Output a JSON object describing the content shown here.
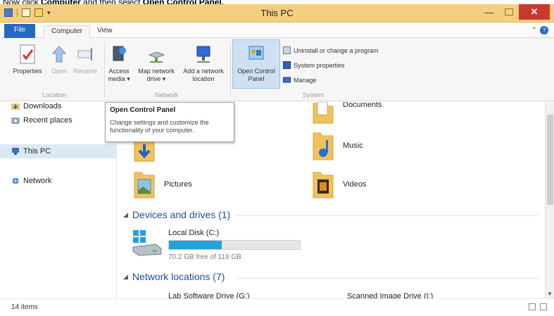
{
  "instruction": {
    "prefix": "Now click ",
    "bold1": "Computer",
    "middle": " and then select ",
    "bold2": "Open Control Panel."
  },
  "window": {
    "title": "This PC"
  },
  "tabs": [
    {
      "label": "File"
    },
    {
      "label": "Computer"
    },
    {
      "label": "View"
    }
  ],
  "ribbon": {
    "location": {
      "label": "Location",
      "properties": "Properties",
      "open": "Open",
      "rename": "Rename"
    },
    "network": {
      "label": "Network",
      "access_media": "Access media ▾",
      "map_drive": "Map network drive ▾",
      "add_location": "Add a network location"
    },
    "system": {
      "label": "System",
      "open_cp": "Open Control Panel",
      "uninstall": "Uninstall or change a program",
      "sys_props": "System properties",
      "manage": "Manage"
    }
  },
  "tooltip": {
    "title": "Open Control Panel",
    "body": "Change settings and customize the functionality of your computer."
  },
  "nav": {
    "items": [
      {
        "label": "Downloads"
      },
      {
        "label": "Recent places"
      },
      {
        "label": "This PC"
      },
      {
        "label": "Network"
      }
    ]
  },
  "folders": [
    {
      "label": "Documents"
    },
    {
      "label": "Downloads"
    },
    {
      "label": "Music"
    },
    {
      "label": "Pictures"
    },
    {
      "label": "Videos"
    }
  ],
  "sections": {
    "devices": "Devices and drives (1)",
    "network": "Network locations (7)"
  },
  "drive": {
    "name": "Local Disk (C:)",
    "free": "70.2 GB free of 118 GB",
    "used_fraction": 0.405
  },
  "network_drives": [
    {
      "label": "Lab Software Drive (G:)"
    },
    {
      "label": "Scanned Image Drive (I:)"
    }
  ],
  "status": {
    "count": "14 items"
  },
  "colors": {
    "title_bar": "#f3cf7f",
    "file_tab": "#2a66c0",
    "close": "#c8392e",
    "section_text": "#1f4e9c",
    "drive_bar": "#26a0da"
  }
}
